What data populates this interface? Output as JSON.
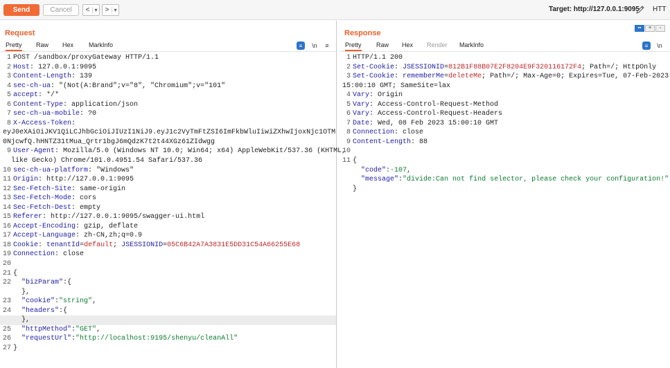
{
  "toolbar": {
    "send_label": "Send",
    "cancel_label": "Cancel",
    "back_symbol": "<",
    "forward_symbol": ">",
    "dropdown_symbol": "▾",
    "target_label": "Target: http://127.0.0.1:9095",
    "help_label": "HTT"
  },
  "request": {
    "title": "Request",
    "tabs": [
      "Pretty",
      "Raw",
      "Hex",
      "MarkInfo"
    ],
    "active_tab": "Pretty",
    "tools": [
      "\\n",
      "≡"
    ],
    "lines": [
      {
        "n": "1",
        "text": "POST /sandbox/proxyGateway HTTP/1.1"
      },
      {
        "n": "2",
        "k": "Host",
        "v": " 127.0.0.1:9095"
      },
      {
        "n": "3",
        "k": "Content-Length",
        "v": " 139"
      },
      {
        "n": "4",
        "k": "sec-ch-ua",
        "v": " \"(Not(A:Brand\";v=\"8\", \"Chromium\";v=\"101\""
      },
      {
        "n": "5",
        "k": "accept",
        "v": " */*"
      },
      {
        "n": "6",
        "k": "Content-Type",
        "v": " application/json"
      },
      {
        "n": "7",
        "k": "sec-ch-ua-mobile",
        "v": " ?0"
      },
      {
        "n": "8",
        "k": "X-Access-Token",
        "v": "",
        "cont": [
          "eyJ0eXAiOiJKV1QiLCJhbGciOiJIUzI1NiJ9.eyJ1c2VyTmFtZSI6ImFkbWluIiwiZXhwIjoxNjc1OTM",
          "0NjcwfQ.hHNTZ31tMua_Qrtr1bgJ6mQdzK7t2t44XGz61ZIdwgg"
        ]
      },
      {
        "n": "9",
        "k": "User-Agent",
        "v": " Mozilla/5.0 (Windows NT 10.0; Win64; x64) AppleWebKit/537.36 (KHTML,",
        "cont": [
          "  like Gecko) Chrome/101.0.4951.54 Safari/537.36"
        ]
      },
      {
        "n": "10",
        "k": "sec-ch-ua-platform",
        "v": " \"Windows\""
      },
      {
        "n": "11",
        "k": "Origin",
        "v": " http://127.0.0.1:9095"
      },
      {
        "n": "12",
        "k": "Sec-Fetch-Site",
        "v": " same-origin"
      },
      {
        "n": "13",
        "k": "Sec-Fetch-Mode",
        "v": " cors"
      },
      {
        "n": "14",
        "k": "Sec-Fetch-Dest",
        "v": " empty"
      },
      {
        "n": "15",
        "k": "Referer",
        "v": " http://127.0.0.1:9095/swagger-ui.html"
      },
      {
        "n": "16",
        "k": "Accept-Encoding",
        "v": " gzip, deflate"
      },
      {
        "n": "17",
        "k": "Accept-Language",
        "v": " zh-CN,zh;q=0.9"
      },
      {
        "n": "18",
        "k": "Cookie",
        "cookies": [
          [
            "tenantId",
            "default"
          ],
          [
            "JSESSIONID",
            "05C6B42A7A3831E5DD31C54A66255E68"
          ]
        ]
      },
      {
        "n": "19",
        "k": "Connection",
        "v": " close"
      },
      {
        "n": "20",
        "text": ""
      },
      {
        "n": "21",
        "text": "{"
      },
      {
        "n": "22",
        "json": [
          [
            "\"bizParam\"",
            ":{"
          ]
        ]
      },
      {
        "n": "",
        "text": "  },"
      },
      {
        "n": "23",
        "json": [
          [
            "\"cookie\"",
            ":"
          ],
          [
            "\"string\"",
            ","
          ]
        ]
      },
      {
        "n": "24",
        "json": [
          [
            "\"headers\"",
            ":{"
          ]
        ]
      },
      {
        "n": "",
        "text": "  },",
        "highlight": true
      },
      {
        "n": "25",
        "json": [
          [
            "\"httpMethod\"",
            ":"
          ],
          [
            "\"GET\"",
            ","
          ]
        ]
      },
      {
        "n": "26",
        "json": [
          [
            "\"requestUrl\"",
            ":"
          ],
          [
            "\"http://localhost:9195/shenyu/cleanAll\"",
            ""
          ]
        ]
      },
      {
        "n": "27",
        "text": "}"
      }
    ]
  },
  "response": {
    "title": "Response",
    "tabs": [
      "Pretty",
      "Raw",
      "Hex",
      "Render",
      "MarkInfo"
    ],
    "active_tab": "Pretty",
    "disabled_tabs": [
      "Render"
    ],
    "tools": [
      "\\n"
    ],
    "lines": [
      {
        "n": "1",
        "text": "HTTP/1.1 200"
      },
      {
        "n": "2",
        "k": "Set-Cookie",
        "cookies": [
          [
            "JSESSIONID",
            "812B1F88B07E2F8204E9F320116172F4"
          ]
        ],
        "tail": "; Path=/; HttpOnly"
      },
      {
        "n": "3",
        "k": "Set-Cookie",
        "cookies": [
          [
            "rememberMe",
            "deleteMe"
          ]
        ],
        "tail": "; Path=/; Max-Age=0; Expires=Tue, 07-Feb-2023",
        "cont": [
          "15:00:10 GMT; SameSite=lax"
        ]
      },
      {
        "n": "4",
        "k": "Vary",
        "v": " Origin"
      },
      {
        "n": "5",
        "k": "Vary",
        "v": " Access-Control-Request-Method"
      },
      {
        "n": "6",
        "k": "Vary",
        "v": " Access-Control-Request-Headers"
      },
      {
        "n": "7",
        "k": "Date",
        "v": " Wed, 08 Feb 2023 15:00:10 GMT"
      },
      {
        "n": "8",
        "k": "Connection",
        "v": " close"
      },
      {
        "n": "9",
        "k": "Content-Length",
        "v": " 88"
      },
      {
        "n": "10",
        "text": ""
      },
      {
        "n": "11",
        "text": "{"
      },
      {
        "n": "",
        "json": [
          [
            "\"code\"",
            ":"
          ],
          [
            "-107",
            ","
          ]
        ]
      },
      {
        "n": "",
        "json": [
          [
            "\"message\"",
            ":"
          ],
          [
            "\"divide:Can not find selector, please check your configuration!\"",
            ""
          ]
        ]
      },
      {
        "n": "",
        "text": "}"
      }
    ]
  },
  "icons": {
    "edit": "pencil-icon",
    "wrap": "newline-icon",
    "menu": "hamburger-icon",
    "pretty": "pretty-print-icon",
    "layout": "layout-toggle-icon"
  },
  "colors": {
    "accent": "#f06a35",
    "header_key": "#1c1ca8",
    "cookie_value": "#c02a2a",
    "json_string": "#0a7a2f",
    "tool_blue": "#2d74c9"
  }
}
